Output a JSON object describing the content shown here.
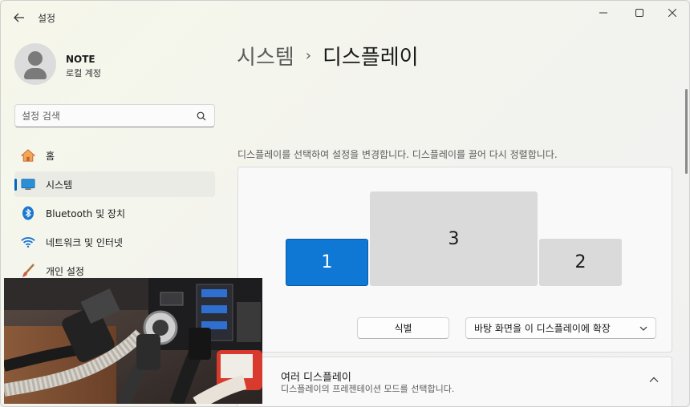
{
  "window": {
    "title": "설정"
  },
  "account": {
    "name": "NOTE",
    "type": "로컬 계정"
  },
  "search": {
    "placeholder": "설정 검색"
  },
  "nav": [
    {
      "label": "홈",
      "icon": "home-icon"
    },
    {
      "label": "시스템",
      "icon": "system-icon",
      "active": true
    },
    {
      "label": "Bluetooth 및 장치",
      "icon": "bluetooth-icon"
    },
    {
      "label": "네트워크 및 인터넷",
      "icon": "wifi-icon"
    },
    {
      "label": "개인 설정",
      "icon": "brush-icon"
    }
  ],
  "breadcrumb": {
    "parent": "시스템",
    "separator": "›",
    "current": "디스플레이"
  },
  "display": {
    "description": "디스플레이를 선택하여 설정을 변경합니다. 디스플레이를 끌어 다시 정렬합니다.",
    "monitors": [
      {
        "label": "1",
        "selected": true
      },
      {
        "label": "3"
      },
      {
        "label": "2"
      }
    ],
    "identify_label": "식별",
    "mode_value": "바탕 화면을 이 디스플레이에 확장"
  },
  "multi_display": {
    "title": "여러 디스플레이",
    "subtitle": "디스플레이의 프레젠테이션 모드를 선택합니다."
  },
  "colors": {
    "accent": "#0067c0",
    "selected_monitor": "#0f78d4"
  }
}
